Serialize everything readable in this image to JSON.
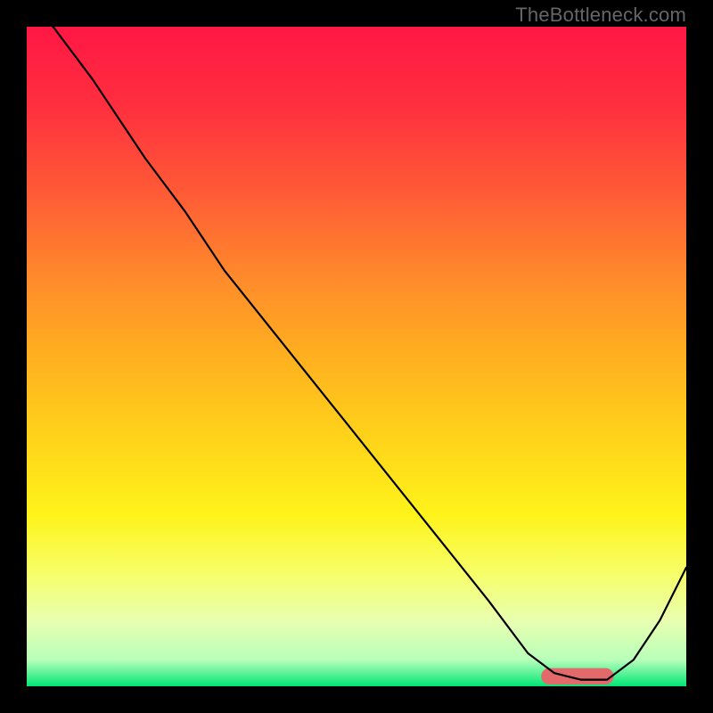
{
  "watermark": "TheBottleneck.com",
  "chart_data": {
    "type": "line",
    "title": "",
    "xlabel": "",
    "ylabel": "",
    "xlim": [
      0,
      100
    ],
    "ylim": [
      0,
      100
    ],
    "legend": false,
    "grid": false,
    "background_gradient": {
      "stops": [
        {
          "offset": 0.0,
          "color": "#ff1744"
        },
        {
          "offset": 0.12,
          "color": "#ff2f3f"
        },
        {
          "offset": 0.25,
          "color": "#ff5a36"
        },
        {
          "offset": 0.38,
          "color": "#ff8a2b"
        },
        {
          "offset": 0.5,
          "color": "#ffb01f"
        },
        {
          "offset": 0.62,
          "color": "#ffd21a"
        },
        {
          "offset": 0.74,
          "color": "#fff31a"
        },
        {
          "offset": 0.83,
          "color": "#f6ff6a"
        },
        {
          "offset": 0.9,
          "color": "#e9ffb0"
        },
        {
          "offset": 0.96,
          "color": "#b8ffba"
        },
        {
          "offset": 1.0,
          "color": "#00e676"
        }
      ]
    },
    "series": [
      {
        "name": "bottleneck-curve",
        "stroke": "#000000",
        "stroke_width": 2.2,
        "x": [
          0,
          4,
          10,
          18,
          24,
          30,
          38,
          46,
          54,
          62,
          70,
          76,
          80,
          84,
          88,
          92,
          96,
          100
        ],
        "y": [
          103,
          100,
          92,
          80,
          72,
          63,
          53,
          43,
          33,
          23,
          13,
          5,
          2,
          1,
          1,
          4,
          10,
          18
        ]
      }
    ],
    "marker": {
      "name": "optimal-range-marker",
      "shape": "rounded-bar",
      "color": "#e26a6a",
      "x_start": 78,
      "x_end": 89,
      "y": 1.5,
      "height": 2.5
    }
  }
}
